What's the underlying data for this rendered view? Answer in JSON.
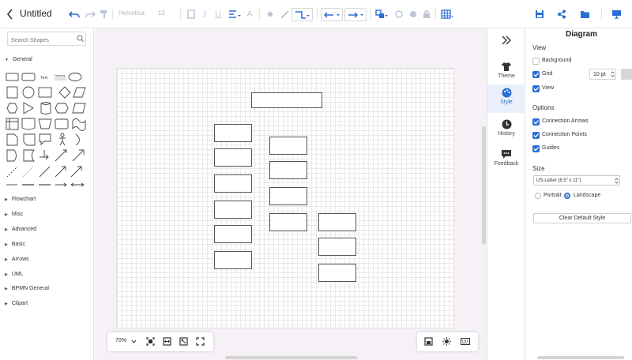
{
  "app": {
    "title": "Untitled"
  },
  "toolbar": {
    "font_name": "Helvetica",
    "font_size": "12"
  },
  "left": {
    "search_placeholder": "Search Shapes",
    "expanded_category": "General",
    "categories": [
      "Flowchart",
      "Misc",
      "Advanced",
      "Basic",
      "Arrows",
      "UML",
      "BPMN General",
      "Clipart"
    ],
    "text_shape_label": "Text",
    "heading_shape_label": "Heading"
  },
  "canvas": {
    "zoom": "70%"
  },
  "rail": {
    "items": [
      "Theme",
      "Style",
      "History",
      "Feedback"
    ],
    "active": "Style"
  },
  "panel": {
    "title": "Diagram",
    "view_section": "View",
    "background_label": "Background",
    "background_checked": false,
    "grid_label": "Grid",
    "grid_checked": true,
    "grid_size": "10 pt",
    "view_label": "View",
    "view_checked": true,
    "options_section": "Options",
    "connection_arrows_label": "Connection Arrows",
    "connection_points_label": "Connection Points",
    "guides_label": "Guides",
    "size_section": "Size",
    "paper_size": "US-Letter (8,5\" x 11\")",
    "portrait_label": "Portrait",
    "landscape_label": "Landscape",
    "orientation": "Landscape",
    "clear_style_label": "Clear Default Style"
  },
  "colors": {
    "accent": "#2b6fd6",
    "canvas_bg": "#f6f0f7"
  }
}
